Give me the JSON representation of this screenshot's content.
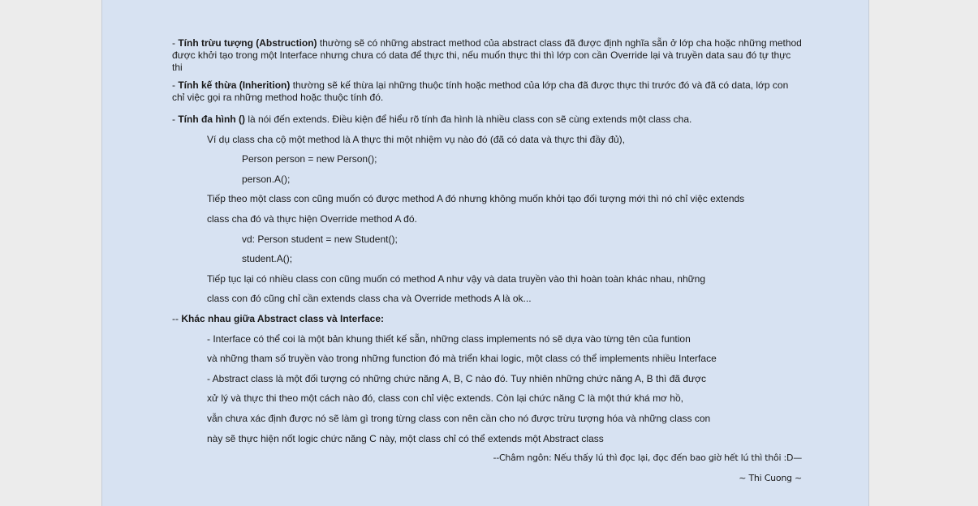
{
  "p1": {
    "lead": "- ",
    "term": "Tính trừu tượng (Abstruction)",
    "text": " thường sẽ có những abstract method của abstract class đã được định nghĩa sẵn ở lớp cha hoặc những method được khởi tạo trong một Interface nhưng chưa có data để thực thi, nếu muốn thực thi thì lớp con cần Override lại và truyền data sau đó tự thực thi"
  },
  "p2": {
    "lead": "- ",
    "term": "Tính kế thừa (Inherition)",
    "text": " thường sẽ kế thừa lại những thuộc tính hoặc method của lớp cha đã được thực thi trước đó và đã có data, lớp con chỉ việc gọi ra những method hoặc thuộc tính đó."
  },
  "p3": {
    "lead": "- ",
    "term": "Tính đa hình ()",
    "text": " là nói đến extends. Điều kiện để hiểu rõ tính đa hình là nhiều class con sẽ cùng extends một class cha."
  },
  "poly_lines": [
    "Ví dụ class cha cộ một method là A thực thi một nhiệm vụ nào đó (đã có data và thực thi đầy đủ),",
    "Person person = new Person();",
    "person.A();",
    "Tiếp theo một class con cũng muốn có được method A đó nhưng không muốn khởi tạo đối tượng mới thì nó chỉ việc extends",
    "class cha đó và thực hiện Override method A đó.",
    "vd: Person student = new Student();",
    "student.A();",
    "Tiếp tục lại có nhiều class con cũng muốn có method A như vậy và data truyền vào thì hoàn toàn khác nhau, những",
    "class con đó cũng chỉ cần extends class cha và Override methods A là ok..."
  ],
  "diff": {
    "lead": "-- ",
    "heading": "Khác nhau giữa Abstract class và Interface:"
  },
  "diff_lines": [
    "- Interface có thể coi là một bản khung thiết kế sẵn, những class implements nó sẽ dựa vào từng tên của funtion",
    "và những tham số truyền vào trong những function đó mà triển khai logic, một class có thể implements nhiều Interface",
    "- Abstract class là một đối tượng có những chức năng A, B, C nào đó. Tuy nhiên những chức năng A, B thì đã được",
    "xử lý và thực thi theo một cách nào đó, class con chỉ việc extends. Còn lại chức năng C là một thứ khá mơ hồ,",
    "vẫn chưa xác định được nó sẽ làm gì trong từng class con nên cần cho nó được trừu tượng hóa và những class con",
    "này sẽ thực hiện nốt logic chức năng C này, một class chỉ có thể extends một Abstract class"
  ],
  "quote": "--Châm ngôn: Nếu thấy lú thì đọc lại, đọc đến bao giờ hết lú thì thôi :D—",
  "signature": "~ Thi Cuong ~"
}
